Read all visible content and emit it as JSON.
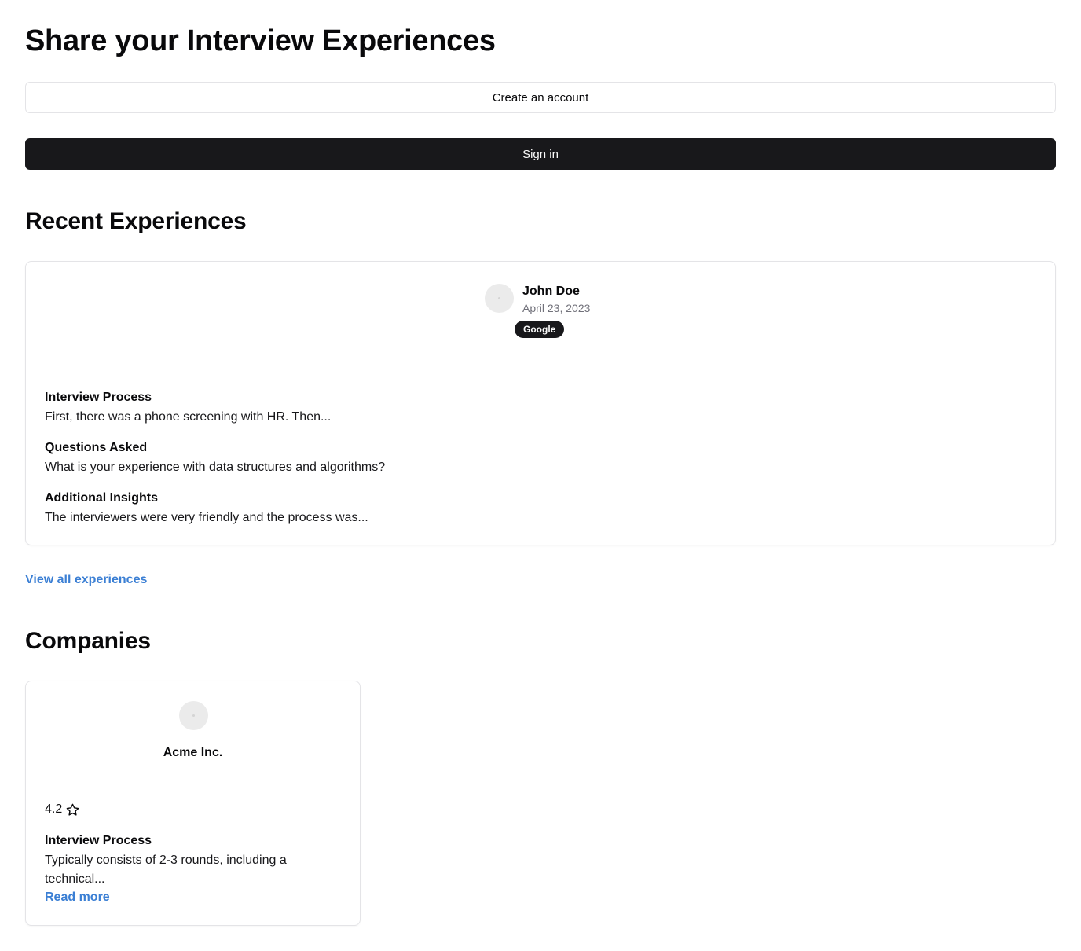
{
  "header": {
    "title": "Share your Interview Experiences"
  },
  "auth": {
    "create_account_label": "Create an account",
    "sign_in_label": "Sign in"
  },
  "recent": {
    "section_title": "Recent Experiences",
    "experiences": [
      {
        "author": "John Doe",
        "date": "April 23, 2023",
        "company_badge": "Google",
        "fields": [
          {
            "label": "Interview Process",
            "value": "First, there was a phone screening with HR. Then..."
          },
          {
            "label": "Questions Asked",
            "value": "What is your experience with data structures and algorithms?"
          },
          {
            "label": "Additional Insights",
            "value": "The interviewers were very friendly and the process was..."
          }
        ]
      }
    ],
    "view_all_label": "View all experiences"
  },
  "companies": {
    "section_title": "Companies",
    "items": [
      {
        "name": "Acme Inc.",
        "rating": "4.2",
        "rating_icon": "star-icon",
        "field_label": "Interview Process",
        "field_value": "Typically consists of 2-3 rounds, including a technical...",
        "read_more_label": "Read more"
      }
    ]
  },
  "colors": {
    "primary_button": "#18181b",
    "link": "#3b7fd4",
    "border": "#e4e4e7",
    "muted_text": "#71717a"
  }
}
